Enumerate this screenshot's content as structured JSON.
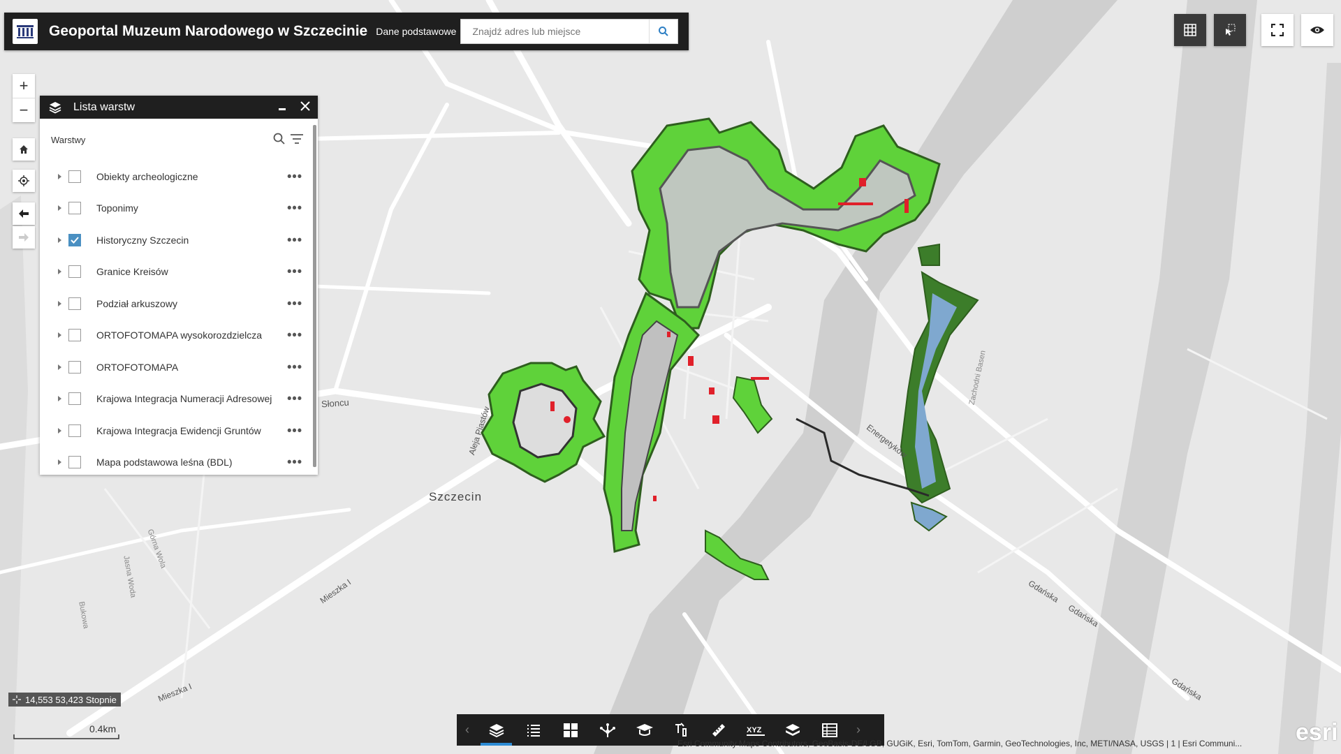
{
  "header": {
    "title": "Geoportal Muzeum Narodowego w Szczecinie",
    "subtitle": "Dane podstawowe",
    "search_placeholder": "Znajdź adres lub miejsce"
  },
  "layer_panel": {
    "title": "Lista warstw",
    "section_label": "Warstwy",
    "layers": [
      {
        "label": "Obiekty archeologiczne",
        "checked": false
      },
      {
        "label": "Toponimy",
        "checked": false
      },
      {
        "label": "Historyczny Szczecin",
        "checked": true
      },
      {
        "label": "Granice Kreisów",
        "checked": false
      },
      {
        "label": "Podział arkuszowy",
        "checked": false
      },
      {
        "label": "ORTOFOTOMAPA wysokorozdzielcza",
        "checked": false
      },
      {
        "label": "ORTOFOTOMAPA",
        "checked": false
      },
      {
        "label": "Krajowa Integracja Numeracji Adresowej",
        "checked": false
      },
      {
        "label": "Krajowa Integracja Ewidencji Gruntów",
        "checked": false
      },
      {
        "label": "Mapa podstawowa leśna (BDL)",
        "checked": false
      }
    ]
  },
  "map": {
    "city_label": "Szczecin",
    "street_labels": [
      "Słoncu",
      "Aleja Piastów",
      "Energetyków",
      "Zachodni Basen",
      "Mieszka I",
      "Mieszka I",
      "Gdańska",
      "Gdańska",
      "Gdańska",
      "Górna Wola",
      "Jasna Woda",
      "Bukowa"
    ],
    "coordinates": "14,553 53,423 Stopnie",
    "scale": "0.4km",
    "attribution": "Esri Community Maps Contributors, GeoBasis-DE/LGB, GUGiK, Esri, TomTom, Garmin, GeoTechnologies, Inc, METI/NASA, USGS | 1 | Esri Communi...",
    "esri_logo": "esri",
    "fortification_color": "#5fd23a",
    "fortification_dark": "#2e5e1e",
    "highlight_color": "#e0202a"
  },
  "toolbar": {
    "icons": [
      "layers-icon",
      "legend-icon",
      "basemap-gallery-icon",
      "analysis-icon",
      "education-icon",
      "draw-icon",
      "measure-icon",
      "xyz-coordinates-icon",
      "layers-stack-icon",
      "attribute-table-icon"
    ]
  }
}
